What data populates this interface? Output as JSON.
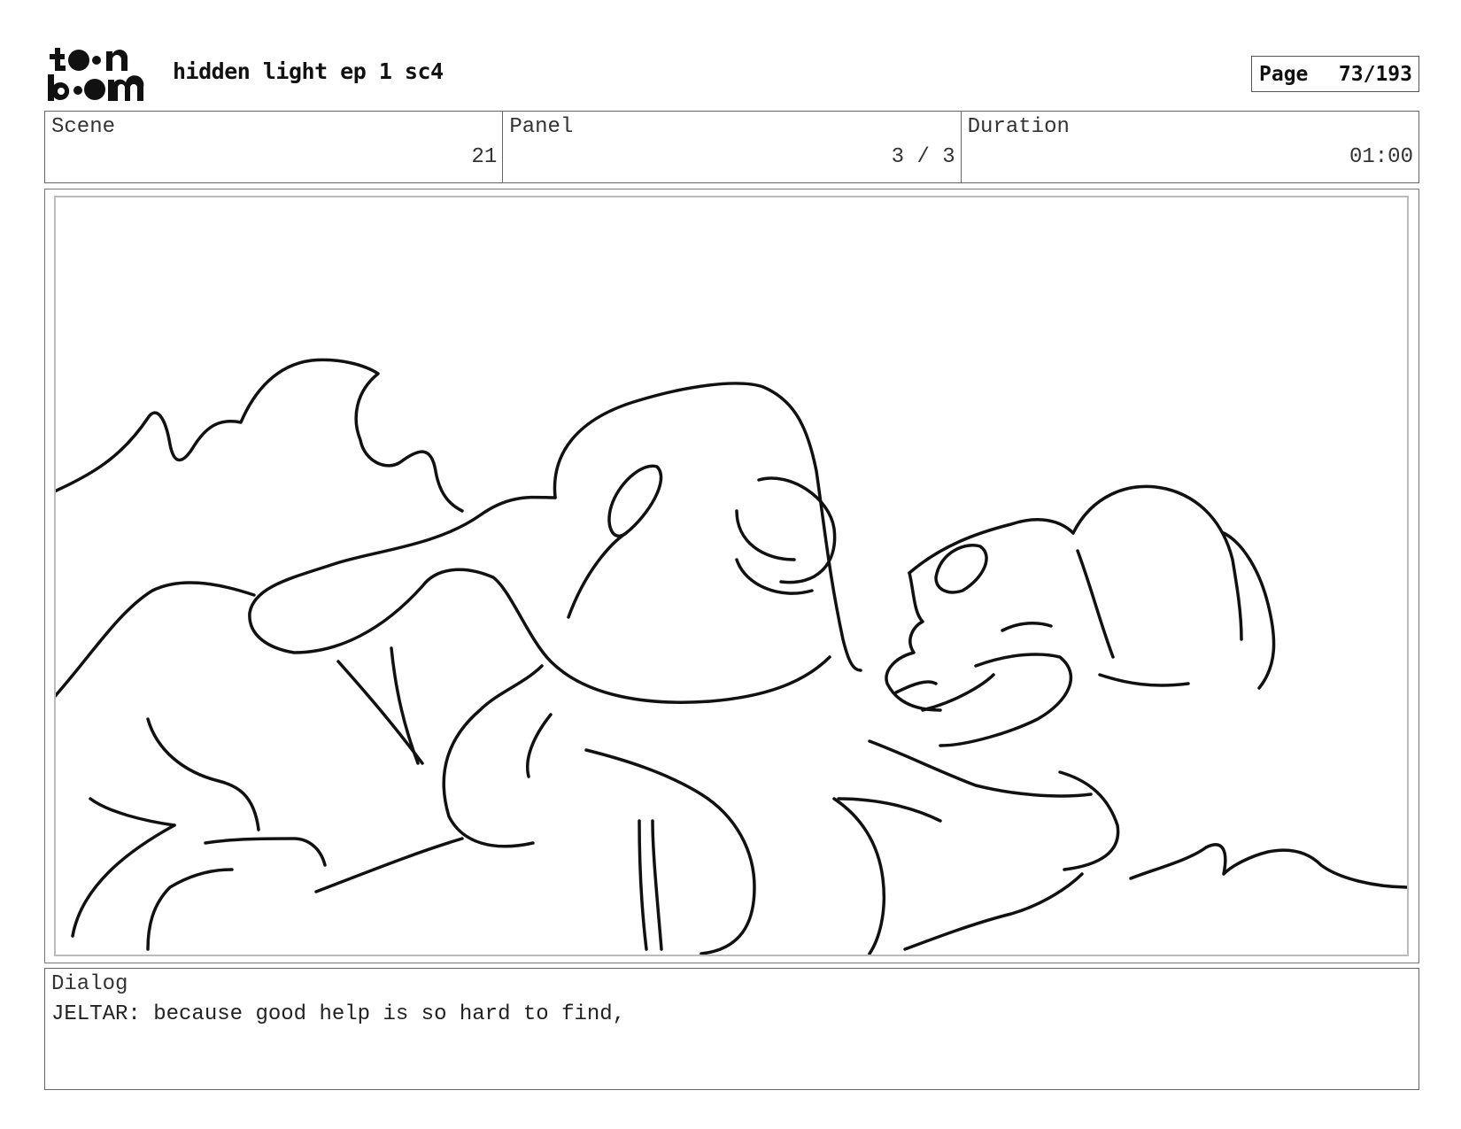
{
  "header": {
    "logo_text": "toonboom",
    "title": "hidden light ep 1 sc4",
    "page_label": "Page",
    "page_value": "73/193"
  },
  "info": {
    "scene_label": "Scene",
    "scene_value": "21",
    "panel_label": "Panel",
    "panel_value": "3 / 3",
    "duration_label": "Duration",
    "duration_value": "01:00"
  },
  "dialog": {
    "label": "Dialog",
    "text": "JELTAR: because good help is so hard to find,"
  }
}
